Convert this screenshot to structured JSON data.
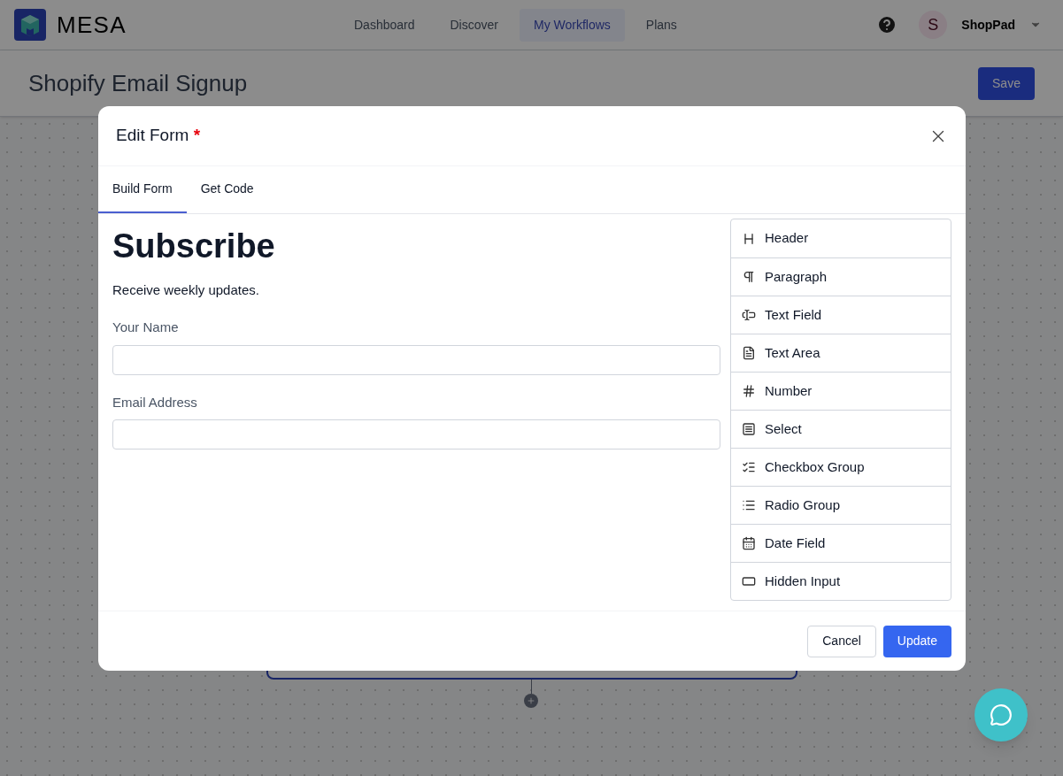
{
  "app": {
    "logo_text": "MESA",
    "nav": [
      {
        "label": "Dashboard",
        "selected": false
      },
      {
        "label": "Discover",
        "selected": false
      },
      {
        "label": "My Workflows",
        "selected": true
      },
      {
        "label": "Plans",
        "selected": false
      }
    ],
    "account": {
      "initial": "S",
      "name": "ShopPad"
    }
  },
  "page": {
    "title": "Shopify Email Signup",
    "save": "Save"
  },
  "dialog": {
    "title": "Edit Form",
    "required_mark": "*",
    "tabs": [
      {
        "label": "Build Form",
        "selected": true
      },
      {
        "label": "Get Code",
        "selected": false
      }
    ],
    "form": {
      "heading": "Subscribe",
      "description": "Receive weekly updates.",
      "fields": [
        {
          "label": "Your Name"
        },
        {
          "label": "Email Address"
        }
      ]
    },
    "palette": [
      {
        "kind": "header",
        "label": "Header"
      },
      {
        "kind": "paragraph",
        "label": "Paragraph"
      },
      {
        "kind": "text-field",
        "label": "Text Field"
      },
      {
        "kind": "text-area",
        "label": "Text Area"
      },
      {
        "kind": "number",
        "label": "Number"
      },
      {
        "kind": "select",
        "label": "Select"
      },
      {
        "kind": "checkbox-group",
        "label": "Checkbox Group"
      },
      {
        "kind": "radio-group",
        "label": "Radio Group"
      },
      {
        "kind": "date",
        "label": "Date Field"
      },
      {
        "kind": "hidden",
        "label": "Hidden Input"
      }
    ],
    "buttons": {
      "cancel": "Cancel",
      "update": "Update"
    }
  }
}
